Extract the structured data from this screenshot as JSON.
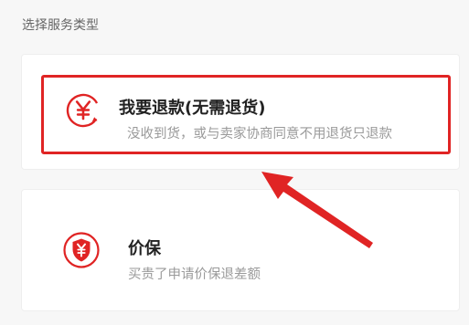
{
  "section": {
    "title": "选择服务类型"
  },
  "options": [
    {
      "title": "我要退款(无需退货)",
      "subtitle": "没收到货，或与卖家协商同意不用退货只退款",
      "icon": "refund-yen-icon",
      "selected": true
    },
    {
      "title": "价保",
      "subtitle": "买贵了申请价保退差额",
      "icon": "price-protect-shield-icon",
      "selected": false
    }
  ],
  "colors": {
    "accent": "#e02424",
    "background": "#f7f7f7",
    "card": "#ffffff",
    "subtitle": "#9a9a9a"
  },
  "annotation": {
    "icon": "red-arrow-pointer"
  }
}
